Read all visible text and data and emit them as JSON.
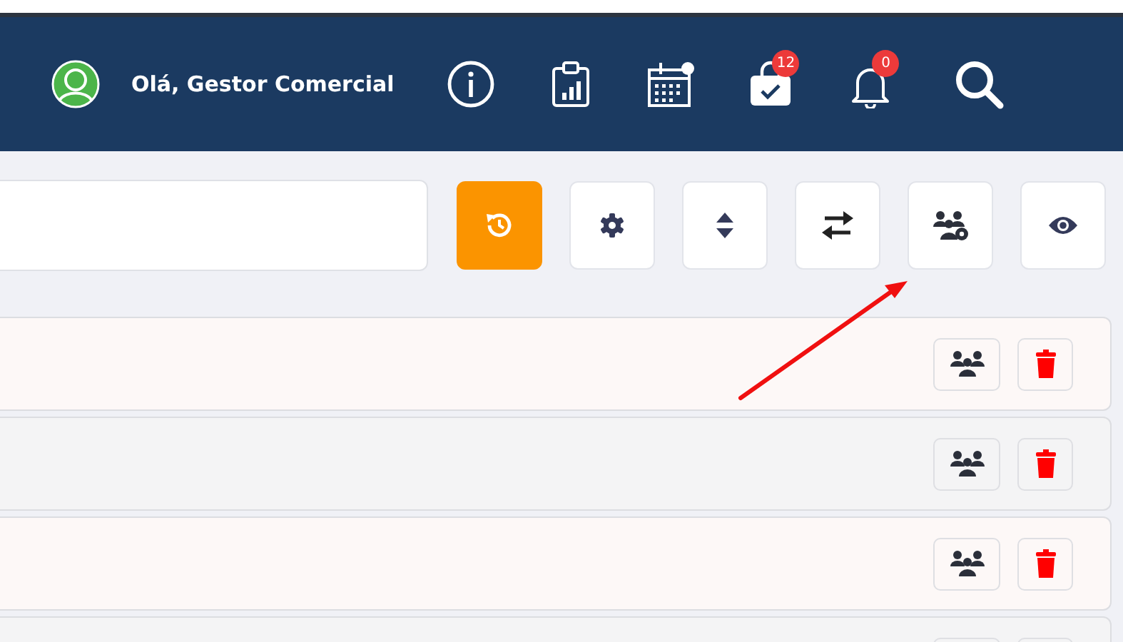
{
  "header": {
    "greeting": "Olá, Gestor Comercial",
    "icons": [
      {
        "kind": "info"
      },
      {
        "kind": "report"
      },
      {
        "kind": "calendar"
      },
      {
        "kind": "tasks",
        "badge": "12"
      },
      {
        "kind": "notifications",
        "badge": "0"
      },
      {
        "kind": "search"
      }
    ]
  },
  "toolbar": [
    {
      "kind": "history",
      "active": true
    },
    {
      "kind": "settings",
      "active": false
    },
    {
      "kind": "sort",
      "active": false
    },
    {
      "kind": "swap",
      "active": false
    },
    {
      "kind": "team-settings",
      "active": false
    },
    {
      "kind": "view",
      "active": false
    }
  ]
}
